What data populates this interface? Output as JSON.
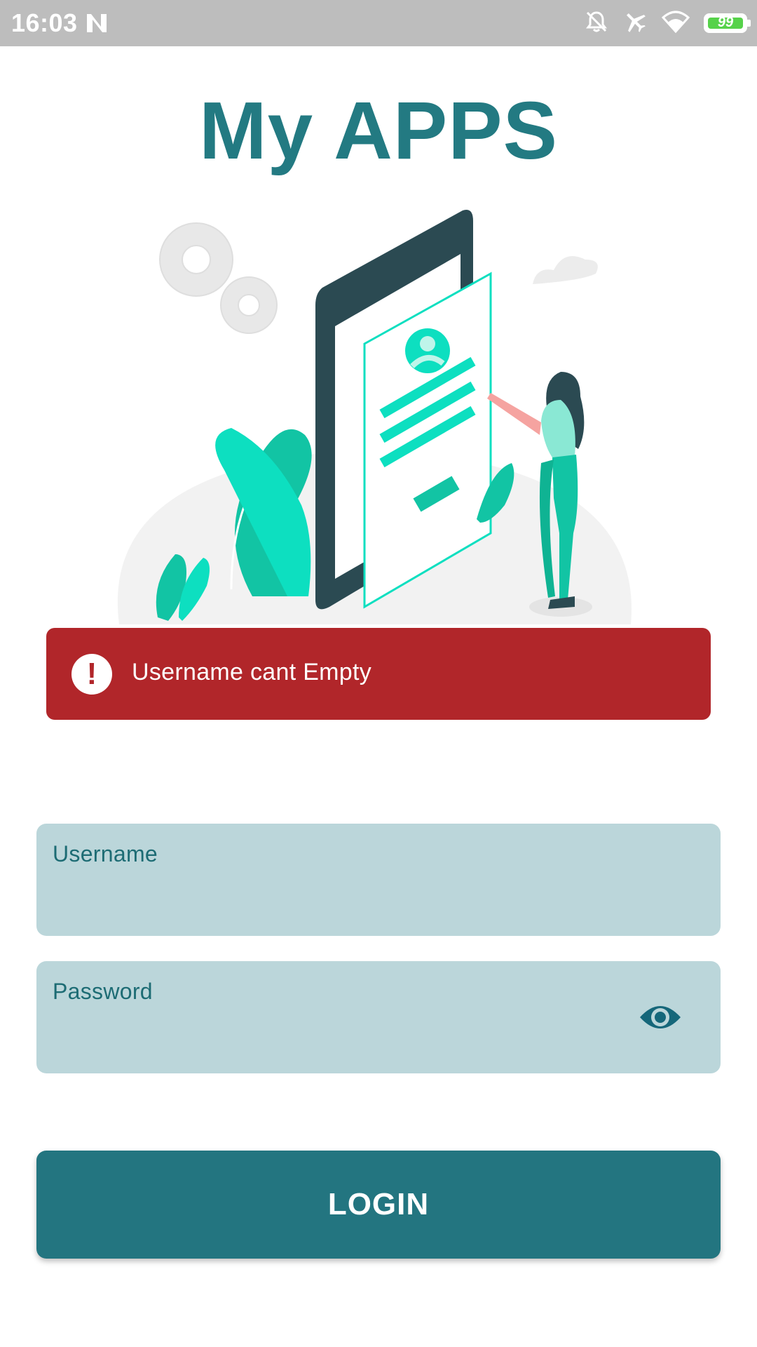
{
  "status_bar": {
    "time": "16:03",
    "battery_level": "99",
    "icons": [
      "n-notification-icon",
      "do-not-disturb-icon",
      "airplane-mode-icon",
      "wifi-icon",
      "battery-icon"
    ]
  },
  "app": {
    "title": "My APPS"
  },
  "illustration": {
    "icon": "login-illustration"
  },
  "error": {
    "icon": "exclamation-icon",
    "message": "Username cant Empty",
    "color": "#b1262a"
  },
  "form": {
    "username": {
      "label": "Username",
      "value": ""
    },
    "password": {
      "label": "Password",
      "value": "",
      "toggle_icon": "eye-icon"
    },
    "login_label": "LOGIN"
  },
  "colors": {
    "primary": "#237a82",
    "field_background": "#bbd6da",
    "status_bar": "#bdbdbd"
  }
}
